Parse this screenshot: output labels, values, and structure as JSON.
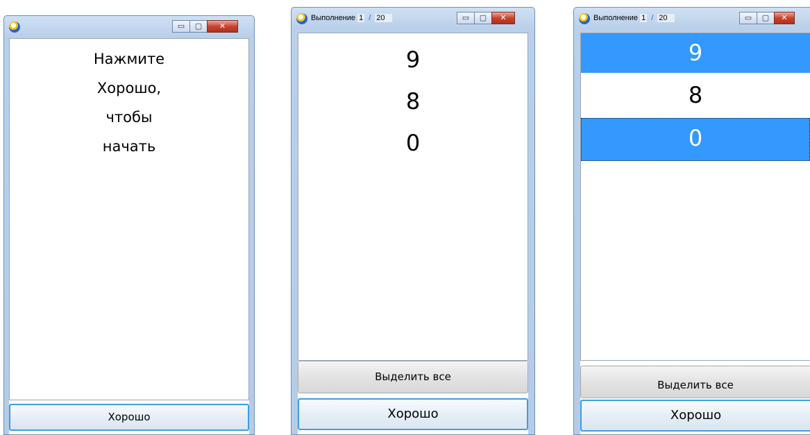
{
  "windows": [
    {
      "title": null,
      "message_lines": [
        "Нажмите",
        "Хорошо,",
        "чтобы",
        "начать"
      ],
      "ok_label": "Хорошо"
    },
    {
      "title": {
        "prefix": "Выполнение",
        "current": "1",
        "sep": "/",
        "total": "20"
      },
      "numbers": [
        {
          "value": "9",
          "selected": false
        },
        {
          "value": "8",
          "selected": false
        },
        {
          "value": "0",
          "selected": false
        }
      ],
      "select_all_label": "Выделить все",
      "ok_label": "Хорошо"
    },
    {
      "title": {
        "prefix": "Выполнение",
        "current": "1",
        "sep": "/",
        "total": "20"
      },
      "numbers": [
        {
          "value": "9",
          "selected": true
        },
        {
          "value": "8",
          "selected": false
        },
        {
          "value": "0",
          "selected": true
        }
      ],
      "select_all_label": "Выделить все",
      "ok_label": "Хорошо"
    }
  ],
  "window_controls": {
    "minimize": "▭",
    "maximize": "▢",
    "close": "✕"
  },
  "colors": {
    "selection": "#3399ff",
    "default_button_border": "#3c9ee0"
  }
}
